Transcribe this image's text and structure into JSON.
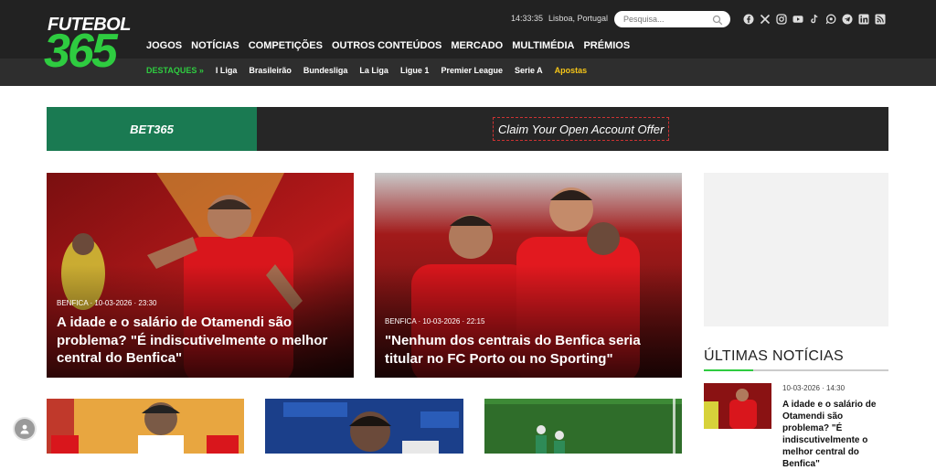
{
  "logo": {
    "top": "FUTEBOL",
    "bottom": "365"
  },
  "header": {
    "time": "14:33:35",
    "location": "Lisboa, Portugal",
    "search_placeholder": "Pesquisa...",
    "socials": [
      "facebook-icon",
      "x-icon",
      "instagram-icon",
      "youtube-icon",
      "tiktok-icon",
      "whatsapp-icon",
      "telegram-icon",
      "linkedin-icon",
      "rss-icon"
    ]
  },
  "mainnav": [
    "JOGOS",
    "NOTÍCIAS",
    "COMPETIÇÕES",
    "OUTROS CONTEÚDOS",
    "MERCADO",
    "MULTIMÉDIA",
    "PRÉMIOS"
  ],
  "subnav": {
    "destaques": "DESTAQUES »",
    "items": [
      "I Liga",
      "Brasileirão",
      "Bundesliga",
      "La Liga",
      "Ligue 1",
      "Premier League",
      "Serie A"
    ],
    "apostas": "Apostas"
  },
  "banner": {
    "brand": "BET365",
    "cta": "Claim Your Open Account Offer"
  },
  "articles": [
    {
      "meta": "BENFICA · 10-03-2026 · 23:30",
      "title": "A idade e o salário de Otamendi são problema? \"É indiscutivelmente o melhor central do Benfica\""
    },
    {
      "meta": "BENFICA · 10-03-2026 · 22:15",
      "title": "\"Nenhum dos centrais do Benfica seria titular no FC Porto ou no Sporting\""
    }
  ],
  "latest": {
    "heading": "ÚLTIMAS NOTÍCIAS",
    "items": [
      {
        "date": "10-03-2026 · 14:30",
        "title": "A idade e o salário de Otamendi são problema? \"É indiscutivelmente o melhor central do Benfica\""
      }
    ]
  },
  "colors": {
    "accent": "#2ecc40",
    "header_bg": "#222222",
    "subnav_bg": "#2e2e2e",
    "bet365_green": "#1a7a52",
    "apostas": "#f5c518"
  }
}
